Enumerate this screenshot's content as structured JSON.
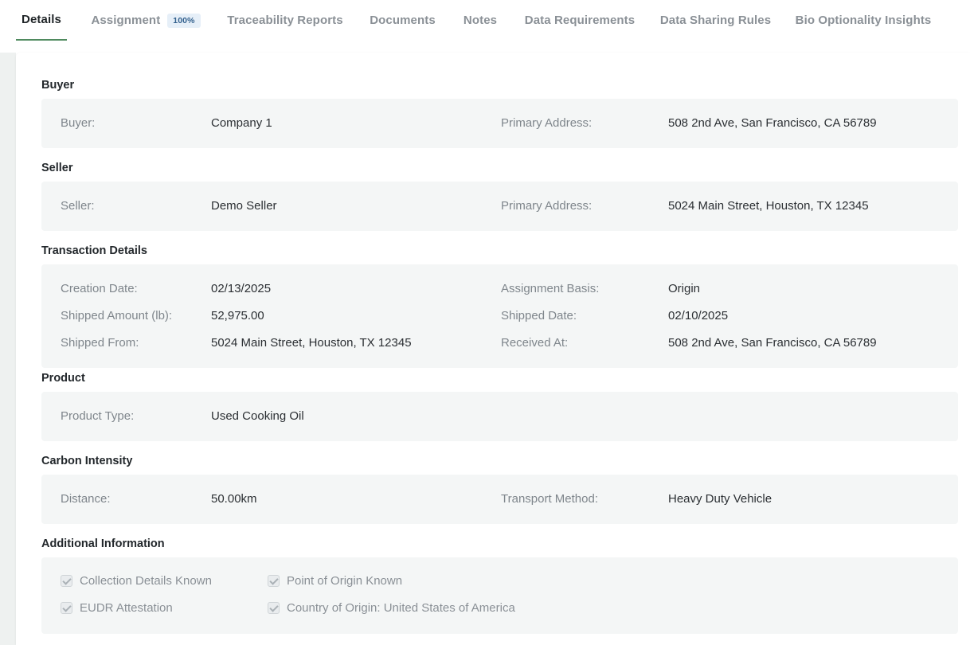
{
  "tabs": [
    {
      "label": "Details",
      "active": true
    },
    {
      "label": "Assignment",
      "badge": "100%"
    },
    {
      "label": "Traceability Reports"
    },
    {
      "label": "Documents"
    },
    {
      "label": "Notes"
    },
    {
      "label": "Data Requirements"
    },
    {
      "label": "Data Sharing Rules"
    },
    {
      "label": "Bio Optionality Insights"
    }
  ],
  "buyer": {
    "title": "Buyer",
    "buyer_label": "Buyer:",
    "buyer_value": "Company 1",
    "address_label": "Primary Address:",
    "address_value": "508 2nd Ave, San Francisco, CA 56789"
  },
  "seller": {
    "title": "Seller",
    "seller_label": "Seller:",
    "seller_value": "Demo Seller",
    "address_label": "Primary Address:",
    "address_value": "5024 Main Street, Houston, TX 12345"
  },
  "transaction": {
    "title": "Transaction Details",
    "creation_date_label": "Creation Date:",
    "creation_date_value": "02/13/2025",
    "assignment_basis_label": "Assignment Basis:",
    "assignment_basis_value": "Origin",
    "shipped_amount_label": "Shipped Amount (lb):",
    "shipped_amount_value": "52,975.00",
    "shipped_date_label": "Shipped Date:",
    "shipped_date_value": "02/10/2025",
    "shipped_from_label": "Shipped From:",
    "shipped_from_value": "5024 Main Street, Houston, TX 12345",
    "received_at_label": "Received At:",
    "received_at_value": "508 2nd Ave, San Francisco, CA 56789"
  },
  "product": {
    "title": "Product",
    "type_label": "Product Type:",
    "type_value": "Used Cooking Oil"
  },
  "carbon": {
    "title": "Carbon Intensity",
    "distance_label": "Distance:",
    "distance_value": "50.00km",
    "transport_label": "Transport Method:",
    "transport_value": "Heavy Duty Vehicle"
  },
  "additional": {
    "title": "Additional Information",
    "checkboxes": [
      {
        "label": "Collection Details Known",
        "checked": true
      },
      {
        "label": "Point of Origin Known",
        "checked": true
      },
      {
        "label": "EUDR Attestation",
        "checked": true
      },
      {
        "label": "Country of Origin: United States of America",
        "checked": true
      }
    ]
  }
}
